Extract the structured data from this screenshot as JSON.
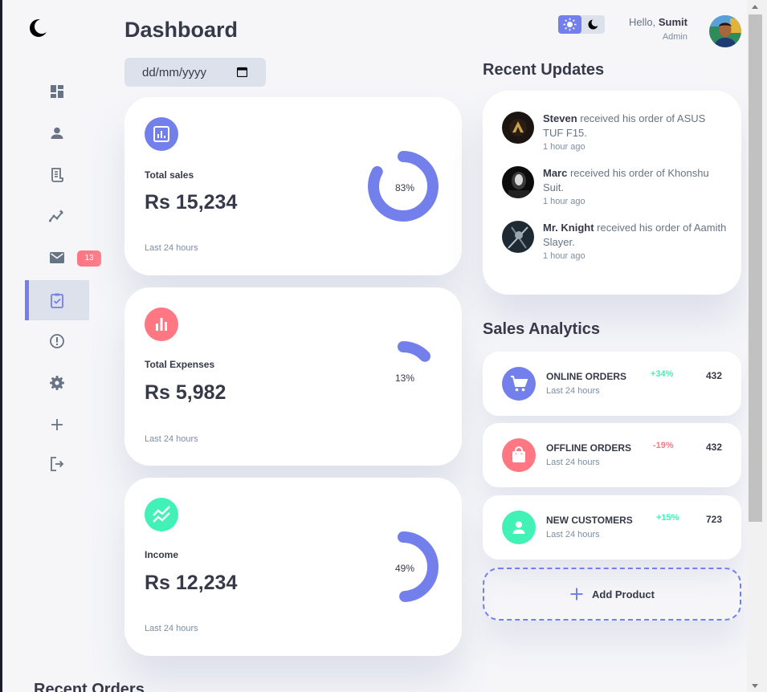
{
  "header": {
    "title": "Dashboard",
    "date_placeholder": "dd/mm/yyyy",
    "greeting": "Hello,",
    "user_name": "Sumit",
    "user_role": "Admin"
  },
  "sidebar": {
    "items": [
      {
        "name": "dashboard",
        "icon": "grid-view-icon"
      },
      {
        "name": "customers",
        "icon": "person-icon"
      },
      {
        "name": "orders",
        "icon": "receipt-icon"
      },
      {
        "name": "analytics",
        "icon": "insights-icon"
      },
      {
        "name": "messages",
        "icon": "mail-icon",
        "badge": "13"
      },
      {
        "name": "products",
        "icon": "clipboard-check-icon",
        "active": true
      },
      {
        "name": "reports",
        "icon": "report-icon"
      },
      {
        "name": "settings",
        "icon": "gear-icon"
      },
      {
        "name": "add-product",
        "icon": "plus-icon"
      },
      {
        "name": "logout",
        "icon": "logout-icon"
      }
    ]
  },
  "cards": [
    {
      "label": "Total sales",
      "value": "Rs 15,234",
      "percent_text": "83%",
      "percent": 0.83,
      "period": "Last 24 hours",
      "icon": "analytics-icon",
      "color": "#7380ec"
    },
    {
      "label": "Total Expenses",
      "value": "Rs 5,982",
      "percent_text": "13%",
      "percent": 0.13,
      "period": "Last 24 hours",
      "icon": "bar-chart-icon",
      "color": "#ff7782"
    },
    {
      "label": "Income",
      "value": "Rs 12,234",
      "percent_text": "49%",
      "percent": 0.49,
      "period": "Last 24 hours",
      "icon": "stacked-line-icon",
      "color": "#41f1b6"
    }
  ],
  "recent_updates": {
    "title": "Recent Updates",
    "items": [
      {
        "name": "Steven",
        "text": " received his order of ASUS TUF F15.",
        "time": "1 hour ago"
      },
      {
        "name": "Marc",
        "text": " received his order of Khonshu Suit.",
        "time": "1 hour ago"
      },
      {
        "name": "Mr. Knight",
        "text": " received his order of Aamith Slayer.",
        "time": "1 hour ago"
      }
    ]
  },
  "sales_analytics": {
    "title": "Sales Analytics",
    "items": [
      {
        "title": "ONLINE ORDERS",
        "period": "Last 24 hours",
        "change": "+34%",
        "count": "432",
        "icon": "cart-icon",
        "color": "#7380ec",
        "change_color": "#41f1b6"
      },
      {
        "title": "OFFLINE ORDERS",
        "period": "Last 24 hours",
        "change": "-19%",
        "count": "432",
        "icon": "shopping-bag-icon",
        "color": "#ff7782",
        "change_color": "#ff7782"
      },
      {
        "title": "NEW CUSTOMERS",
        "period": "Last 24 hours",
        "change": "+15%",
        "count": "723",
        "icon": "person-icon",
        "color": "#41f1b6",
        "change_color": "#41f1b6"
      }
    ],
    "add_label": "Add Product"
  },
  "recent_orders": {
    "title": "Recent Orders"
  },
  "colors": {
    "primary": "#7380ec",
    "danger": "#ff7782",
    "success": "#41f1b6",
    "background": "#f6f6f9",
    "light": "#dce1eb"
  }
}
